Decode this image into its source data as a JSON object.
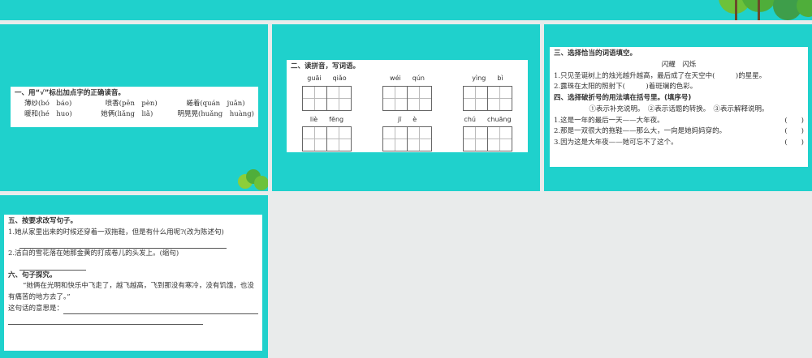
{
  "slide1": {
    "title": "一、用“√”标出加点字的正确读音。",
    "items": [
      "薄纱(bó　báo)",
      "喷香(pēn　pèn)",
      "蜷着(quán　juǎn)",
      "暖和(hé　huo)",
      "她俩(liǎng　liǎ)",
      "明晃晃(huǎng　huàng)"
    ]
  },
  "slide2": {
    "title": "二、读拼音，写词语。",
    "words": [
      [
        "guāi",
        "qiǎo"
      ],
      [
        "wéi",
        "qún"
      ],
      [
        "yìng",
        "bì"
      ],
      [
        "liè",
        "fēng"
      ],
      [
        "jī",
        "è"
      ],
      [
        "chú",
        "chuāng"
      ]
    ]
  },
  "slide3": {
    "title3": "三、选择恰当的词语填空。",
    "choices": "闪耀　闪烁",
    "q3": [
      "1.只见圣诞树上的烛光越升越高，最后成了在天空中(　　　)的星星。",
      "2.露珠在太阳的照射下(　　　)着斑斓的色彩。"
    ],
    "title4": "四、选择破折号的用法填在括号里。(填序号)",
    "options": "①表示补充说明。　②表示话题的转换。　③表示解释说明。",
    "q4": [
      "1.这是一年的最后一天——大年夜。",
      "2.那是一双很大的拖鞋——那么大，一向是她妈妈穿的。",
      "3.因为这是大年夜——她可忘不了这个。"
    ],
    "paren": "(　　)"
  },
  "slide4": {
    "title5": "五、按要求改写句子。",
    "q5_1": "1.她从家里出来的时候还穿着一双拖鞋，但是有什么用呢?(改为陈述句)",
    "q5_2": "2.洁白的雪花落在她那金黄的打成卷儿的头发上。(缩句)",
    "title6": "六、句子探究。",
    "quote": "“她俩在光明和快乐中飞走了，越飞越高，飞到那没有寒冷，没有饥饿，也没有痛苦的地方去了。”",
    "prompt": "这句话的意思是："
  }
}
